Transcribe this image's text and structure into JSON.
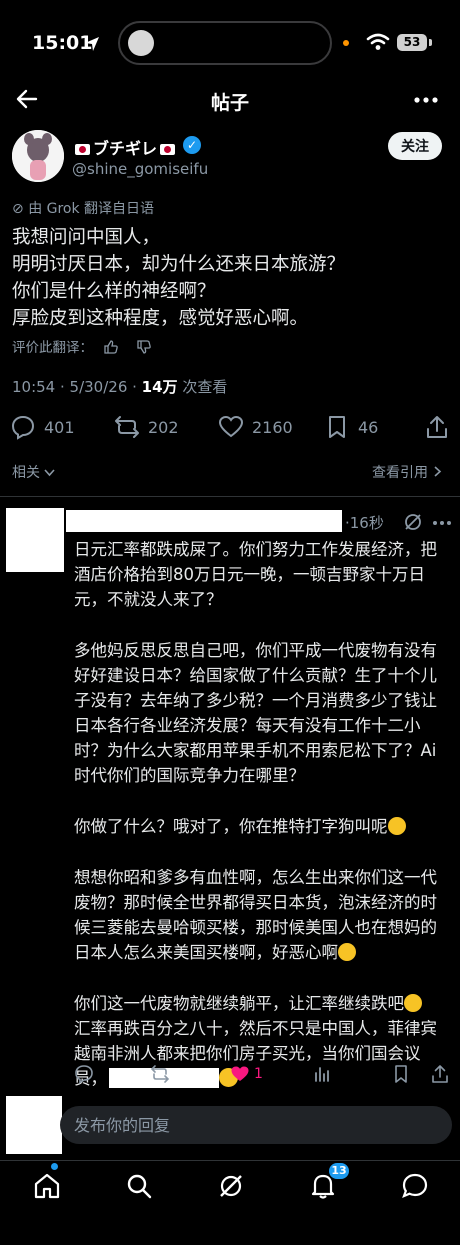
{
  "status_bar": {
    "time": "15:01",
    "battery": "53"
  },
  "header": {
    "title": "帖子"
  },
  "post": {
    "author_name": "ブチギレ",
    "handle": "@shine_gomiseifu",
    "follow_label": "关注",
    "translated_by": "由 Grok 翻译自日语",
    "text": "我想问问中国人，\n明明讨厌日本，却为什么还来日本旅游？\n你们是什么样的神经啊？\n厚脸皮到这种程度，感觉好恶心啊。",
    "rate_translation": "评价此翻译：",
    "timestamp": "10:54 · 5/30/26 · ",
    "views": "14万",
    "views_label": " 次查看",
    "replies": "401",
    "reposts": "202",
    "likes": "2160",
    "bookmarks": "46",
    "related": "相关",
    "view_quotes": "查看引用"
  },
  "reply": {
    "time": "·16秒",
    "paragraphs": [
      "日元汇率都跌成屎了。你们努力工作发展经济，把酒店价格抬到80万日元一晚，一顿吉野家十万日元，不就没人来了？",
      "多他妈反思反思自己吧，你们平成一代废物有没有好好建设日本？给国家做了什么贡献？生了十个儿子没有？去年纳了多少税？一个月消费多少了钱让日本各行各业经济发展？每天有没有工作十二小时？为什么大家都用苹果手机不用索尼松下了？Ai时代你们的国际竞争力在哪里？",
      "你做了什么？哦对了，你在推特打字狗叫呢",
      "想想你昭和爹多有血性啊，怎么生出来你们这一代废物？那时候全世界都得买日本货，泡沫经济的时候三菱能去曼哈顿买楼，那时候美国人也在想妈的日本人怎么来美国买楼啊，好恶心啊",
      "你们这一代废物就继续躺平，让汇率继续跌吧",
      "汇率再跌百分之八十，然后不只是中国人，菲律宾越南非洲人都来把你们房子买光，当你们国会议员，"
    ],
    "likes": "1"
  },
  "compose": {
    "placeholder": "发布你的回复"
  },
  "tabbar": {
    "notifications_badge": "13"
  },
  "colors": {
    "accent": "#1d9bf0",
    "like_active": "#f91880",
    "muted": "#8b98a5"
  }
}
